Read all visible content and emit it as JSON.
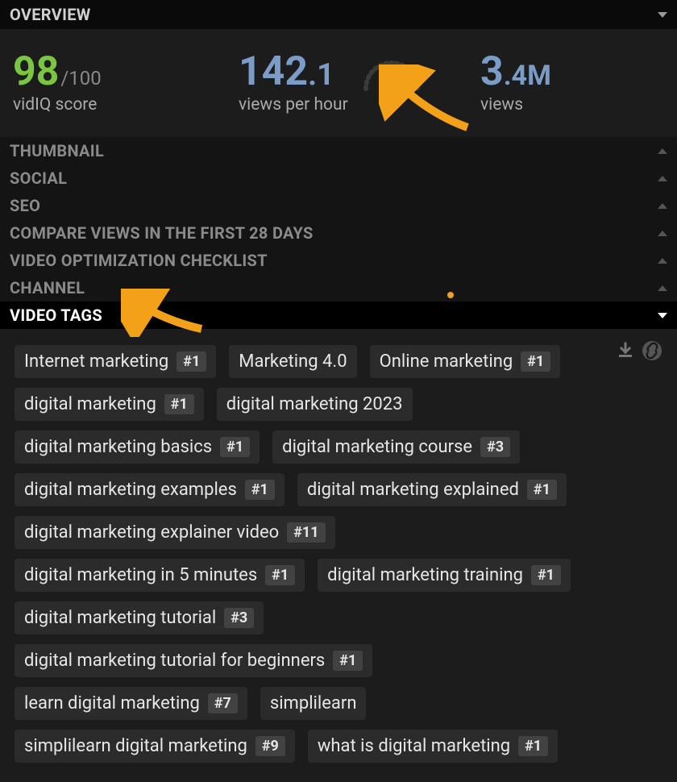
{
  "sections": {
    "overview": "OVERVIEW",
    "thumbnail": "THUMBNAIL",
    "social": "SOCIAL",
    "seo": "SEO",
    "compare": "COMPARE VIEWS IN THE FIRST 28 DAYS",
    "checklist": "VIDEO OPTIMIZATION CHECKLIST",
    "channel": "CHANNEL",
    "video_tags": "VIDEO TAGS"
  },
  "overview": {
    "score_main": "98",
    "score_sub": "/100",
    "score_label": "vidIQ score",
    "vph_main": "142",
    "vph_sub": ".1",
    "vph_label": "views per hour",
    "views_main": "3",
    "views_sub": ".4",
    "views_unit": "M",
    "views_label": "views"
  },
  "tags": [
    {
      "text": "Internet marketing",
      "rank": "#1"
    },
    {
      "text": "Marketing 4.0",
      "rank": null
    },
    {
      "text": "Online marketing",
      "rank": "#1"
    },
    {
      "text": "digital marketing",
      "rank": "#1"
    },
    {
      "text": "digital marketing 2023",
      "rank": null
    },
    {
      "text": "digital marketing basics",
      "rank": "#1"
    },
    {
      "text": "digital marketing course",
      "rank": "#3"
    },
    {
      "text": "digital marketing examples",
      "rank": "#1"
    },
    {
      "text": "digital marketing explained",
      "rank": "#1"
    },
    {
      "text": "digital marketing explainer video",
      "rank": "#11"
    },
    {
      "text": "digital marketing in 5 minutes",
      "rank": "#1"
    },
    {
      "text": "digital marketing training",
      "rank": "#1"
    },
    {
      "text": "digital marketing tutorial",
      "rank": "#3"
    },
    {
      "text": "digital marketing tutorial for beginners",
      "rank": "#1"
    },
    {
      "text": "learn digital marketing",
      "rank": "#7"
    },
    {
      "text": "simplilearn",
      "rank": null
    },
    {
      "text": "simplilearn digital marketing",
      "rank": "#9"
    },
    {
      "text": "what is digital marketing",
      "rank": "#1"
    }
  ]
}
